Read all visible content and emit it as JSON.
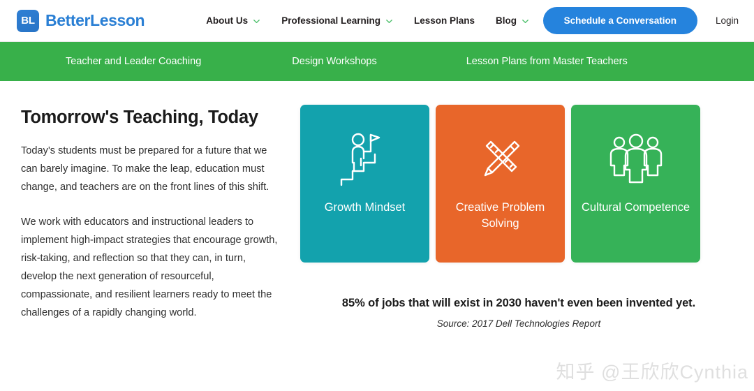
{
  "header": {
    "brand": {
      "mark": "BL",
      "name": "BetterLesson"
    },
    "nav_items": [
      {
        "label": "About Us",
        "has_chevron": true
      },
      {
        "label": "Professional Learning",
        "has_chevron": true
      },
      {
        "label": "Lesson Plans",
        "has_chevron": false
      },
      {
        "label": "Blog",
        "has_chevron": true
      }
    ],
    "cta_label": "Schedule a Conversation",
    "login_label": "Login"
  },
  "subnav": {
    "items": [
      {
        "label": "Teacher and Leader Coaching"
      },
      {
        "label": "Design Workshops"
      },
      {
        "label": "Lesson Plans from Master Teachers"
      }
    ]
  },
  "main": {
    "headline": "Tomorrow's Teaching, Today",
    "paragraphs": [
      "Today's students must be prepared for a future that we can barely imagine. To make the leap, education must change, and teachers are on the front lines of this shift.",
      "We work with educators and instructional leaders to implement high-impact strategies that encourage growth, risk-taking, and reflection so that they can, in turn, develop the next generation of resourceful, compassionate, and resilient learners ready to meet the challenges of a rapidly changing world."
    ],
    "cards": [
      {
        "label": "Growth Mindset",
        "color": "#13a2ad",
        "icon": "person-climbing-stairs-with-flag-icon"
      },
      {
        "label": "Creative Problem Solving",
        "color": "#e8662a",
        "icon": "pencil-and-ruler-icon"
      },
      {
        "label": "Cultural Competence",
        "color": "#36b258",
        "icon": "three-people-icon"
      }
    ],
    "stat": {
      "headline": "85% of jobs that will exist in 2030 haven't even been invented yet.",
      "source": "Source: 2017 Dell Technologies Report"
    }
  },
  "watermark": {
    "text": "知乎 @王欣欣Cynthia"
  },
  "colors": {
    "brand_blue": "#2a7fd4",
    "cta_blue": "#2583dd",
    "subnav_green": "#38b04a",
    "chevron_green": "#4cbf6a",
    "card_teal": "#13a2ad",
    "card_orange": "#e8662a",
    "card_green": "#36b258"
  }
}
